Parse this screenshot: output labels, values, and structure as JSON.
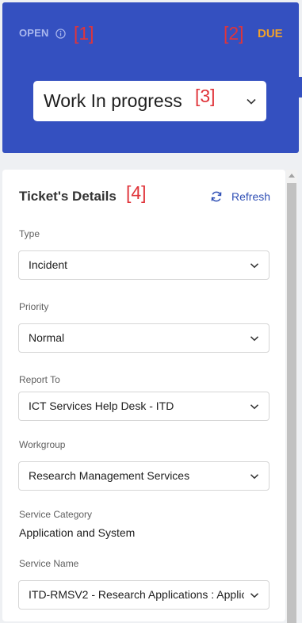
{
  "status": {
    "open_label": "OPEN",
    "due_label": "DUE",
    "selected_status": "Work In progress",
    "colors": {
      "panel": "#3450c0",
      "due": "#f2a12a",
      "open": "#aab8ee"
    }
  },
  "markers": {
    "m1": "[1]",
    "m2": "[2]",
    "m3": "[3]",
    "m4": "[4]"
  },
  "details": {
    "title": "Ticket's Details",
    "refresh_label": "Refresh",
    "fields": {
      "type": {
        "label": "Type",
        "value": "Incident"
      },
      "priority": {
        "label": "Priority",
        "value": "Normal"
      },
      "report_to": {
        "label": "Report To",
        "value": "ICT Services Help Desk - ITD"
      },
      "workgroup": {
        "label": "Workgroup",
        "value": "Research Management Services"
      },
      "service_category": {
        "label": "Service Category",
        "value": "Application and System"
      },
      "service_name": {
        "label": "Service Name",
        "value": "ITD-RMSV2 - Research Applications : Applic"
      }
    }
  },
  "icons": [
    "info-icon",
    "chevron-down-icon",
    "refresh-icon"
  ]
}
